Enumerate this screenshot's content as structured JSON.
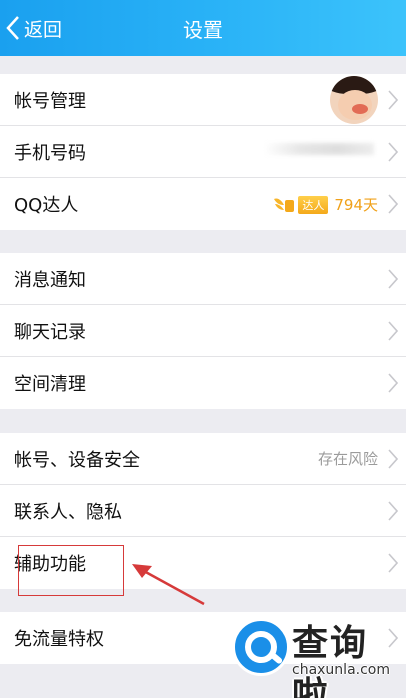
{
  "header": {
    "back_label": "返回",
    "title": "设置"
  },
  "groups": [
    {
      "rows": [
        {
          "label": "帐号管理"
        },
        {
          "label": "手机号码"
        },
        {
          "label": "QQ达人",
          "badge_tag": "达人",
          "days": "794天"
        }
      ]
    },
    {
      "rows": [
        {
          "label": "消息通知"
        },
        {
          "label": "聊天记录"
        },
        {
          "label": "空间清理"
        }
      ]
    },
    {
      "rows": [
        {
          "label": "帐号、设备安全",
          "value": "存在风险"
        },
        {
          "label": "联系人、隐私"
        },
        {
          "label": "辅助功能"
        }
      ]
    },
    {
      "rows": [
        {
          "label": "免流量特权"
        }
      ]
    }
  ],
  "watermark": {
    "title": "查询啦",
    "domain": "chaxunla.com"
  },
  "colors": {
    "header": "#22aaf3",
    "accent": "#f0a11a",
    "annotation": "#d63a3a",
    "watermark_blue": "#1a8fe8"
  },
  "icons": {
    "back": "chevron-left-icon",
    "row_chevron": "chevron-right-icon",
    "qq_master": "wing-badge-icon"
  }
}
